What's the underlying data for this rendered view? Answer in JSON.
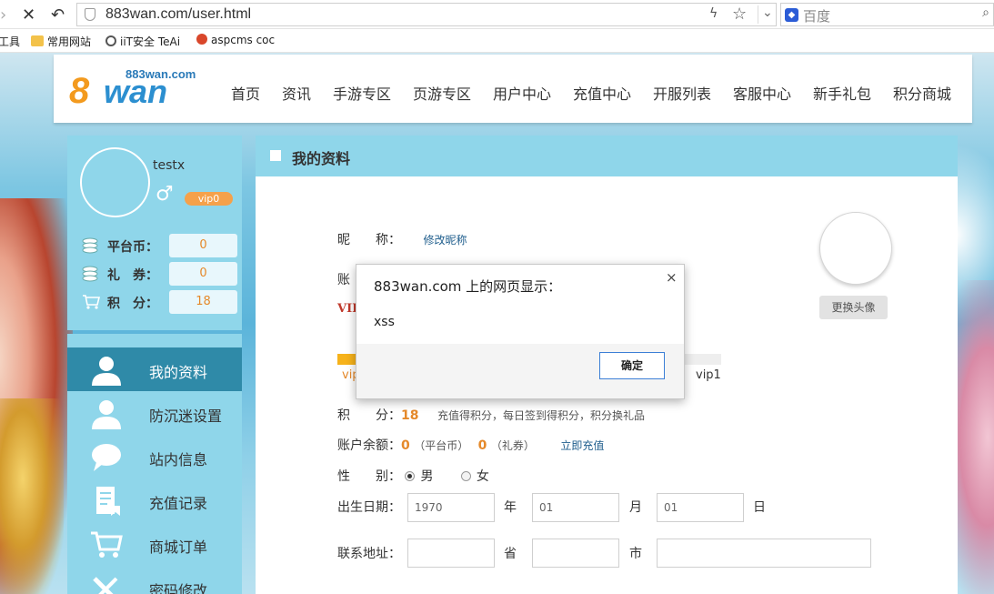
{
  "browser": {
    "url": "883wan.com/user.html",
    "search_placeholder": "百度",
    "bookmarks": [
      "工具",
      "常用网站",
      "iiT安全 TeAi",
      "aspcms coc"
    ]
  },
  "site": {
    "logo_domain": "883wan.com",
    "logo_num": "8",
    "logo_word": "wan",
    "nav": [
      "首页",
      "资讯",
      "手游专区",
      "页游专区",
      "用户中心",
      "充值中心",
      "开服列表",
      "客服中心",
      "新手礼包",
      "积分商城"
    ]
  },
  "user": {
    "name": "testx",
    "gender_symbol": "♂",
    "vip": "vip0",
    "stats": [
      {
        "label": "平台币：",
        "value": "0"
      },
      {
        "label": "礼　券：",
        "value": "0"
      },
      {
        "label": "积　分：",
        "value": "18"
      }
    ]
  },
  "menu": [
    "我的资料",
    "防沉迷设置",
    "站内信息",
    "充值记录",
    "商城订单",
    "密码修改"
  ],
  "profile": {
    "title": "我的资料",
    "nickname_label": "昵　　称：",
    "nickname_link": "修改昵称",
    "account_label_partial": "账",
    "vip_partial": "VIP",
    "vip_start": "vip",
    "vip_end": "vip1",
    "progress_fraction": 0.05,
    "points_label": "积　　分：",
    "points_value": "18",
    "points_hint": "充值得积分，每日签到得积分，积分换礼品",
    "balance_label": "账户余额：",
    "balance_platform": "0",
    "balance_platform_unit": "（平台币）",
    "balance_coupon": "0",
    "balance_coupon_unit": "（礼券）",
    "recharge_link": "立即充值",
    "gender_label": "性　　别：",
    "gender_male": "男",
    "gender_female": "女",
    "birth_label": "出生日期：",
    "birth_year": "1970",
    "birth_year_unit": "年",
    "birth_month": "01",
    "birth_month_unit": "月",
    "birth_day": "01",
    "birth_day_unit": "日",
    "address_label": "联系地址：",
    "province_unit": "省",
    "city_unit": "市",
    "avatar_button": "更换头像"
  },
  "dialog": {
    "title": "883wan.com 上的网页显示：",
    "message": "xss",
    "close": "×",
    "ok": "确定"
  }
}
